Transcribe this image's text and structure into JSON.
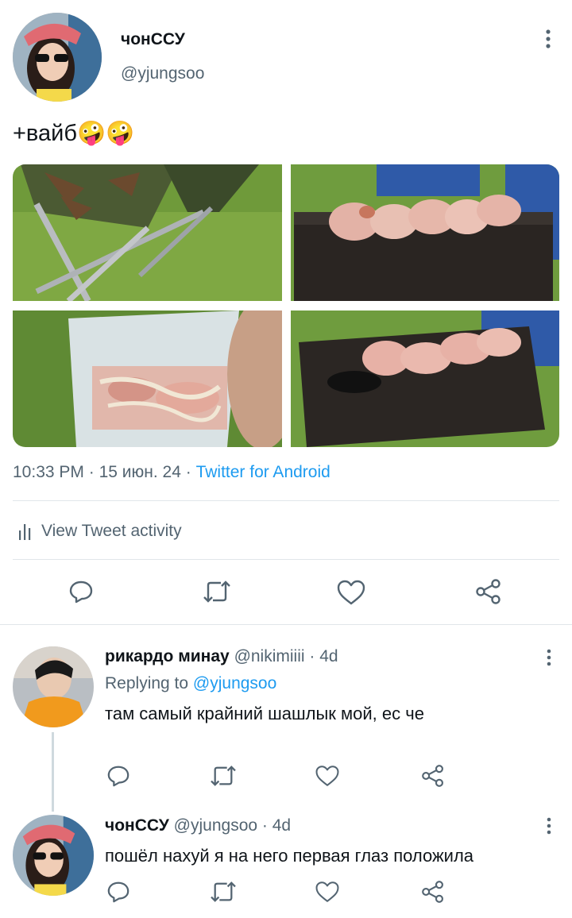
{
  "tweet": {
    "author_name": "чонССУ",
    "author_handle": "@yjungsoo",
    "text": "+вайб🤪🤪",
    "time": "10:33 PM",
    "date": "15 июн. 24",
    "source": "Twitter for Android",
    "separator": "·",
    "activity_label": "View Tweet activity"
  },
  "replies": [
    {
      "author_name": "рикардо минау",
      "author_handle": "@nikimiiii",
      "age": "4d",
      "replying_to_label": "Replying to",
      "replying_to_handle": "@yjungsoo",
      "text": "там самый крайний шашлык мой, ес че"
    },
    {
      "author_name": "чонССУ",
      "author_handle": "@yjungsoo",
      "age": "4d",
      "text": "пошёл нахуй я на него первая глаз положила"
    }
  ],
  "icons": {
    "more": "more-vertical-icon",
    "reply": "comment-icon",
    "retweet": "retweet-icon",
    "like": "heart-icon",
    "share": "share-icon",
    "activity": "bar-chart-icon"
  },
  "colors": {
    "text": "#0f1419",
    "muted": "#536471",
    "link": "#1d9bf0",
    "divider": "#e1e6ea"
  }
}
